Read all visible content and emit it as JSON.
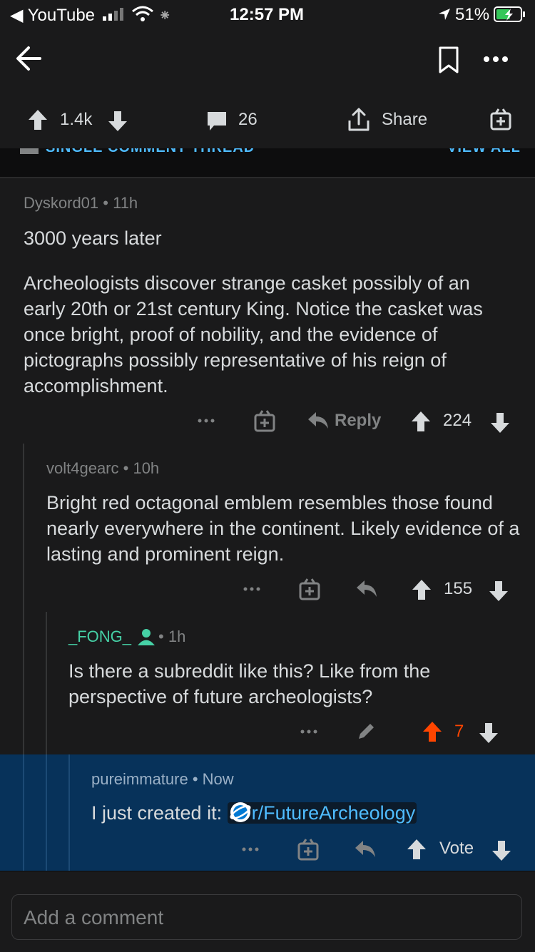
{
  "status_bar": {
    "back_app": "YouTube",
    "time": "12:57 PM",
    "battery": "51%"
  },
  "post_actions": {
    "votes": "1.4k",
    "comments": "26",
    "share_label": "Share"
  },
  "thread_header": {
    "left": "SINGLE COMMENT THREAD",
    "right": "VIEW ALL"
  },
  "comments": [
    {
      "author": "Dyskord01",
      "age": "11h",
      "title": "3000 years later",
      "body": "Archeologists discover strange casket possibly of an early 20th or 21st century King. Notice the casket was once bright, proof of nobility, and the evidence of pictographs possibly representative of his reign of accomplishment.",
      "reply_label": "Reply",
      "score": "224"
    },
    {
      "author": "volt4gearc",
      "age": "10h",
      "body": "Bright red octagonal emblem resembles those found nearly everywhere in the continent. Likely evidence of a lasting and prominent reign.",
      "score": "155"
    },
    {
      "author": "_FONG_",
      "age": "1h",
      "body": "Is there a subreddit like this? Like from the perspective of future archeologists?",
      "score": "7"
    },
    {
      "author": "pureimmature",
      "age": "Now",
      "body_prefix": "I just created it:",
      "subreddit_link": "r/FutureArcheology",
      "vote_label": "Vote"
    }
  ],
  "comment_input": {
    "placeholder": "Add a comment"
  },
  "colors": {
    "link": "#4fbcff",
    "upvoted": "#ff4500",
    "highlight": "#07325a",
    "op_badge": "#46d1a6"
  }
}
